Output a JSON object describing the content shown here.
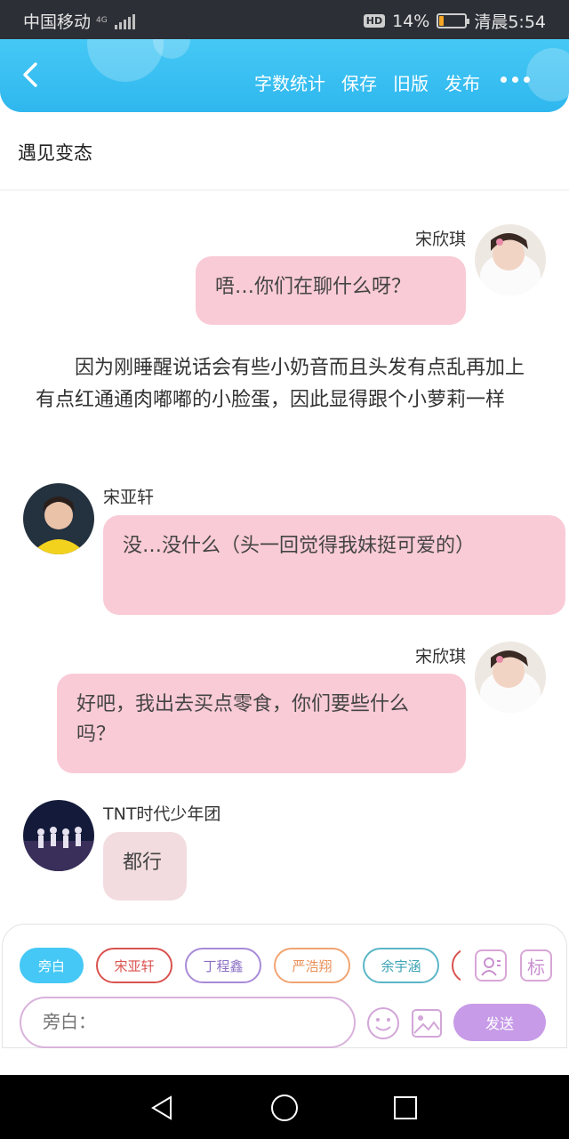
{
  "status": {
    "carrier": "中国移动",
    "net": "4G",
    "battery": "14%",
    "time": "清晨5:54",
    "battery_level": 0.14
  },
  "header": {
    "buttons": [
      "字数统计",
      "保存",
      "旧版",
      "发布"
    ]
  },
  "story": {
    "title": "遇见变态"
  },
  "messages": [
    {
      "name": "宋欣琪",
      "text": "唔…你们在聊什么呀？"
    },
    {
      "narration": "因为刚睡醒说话会有些小奶音而且头发有点乱再加上有点红通通肉嘟嘟的小脸蛋，因此显得跟个小萝莉一样"
    },
    {
      "name": "宋亚轩",
      "text": "没…没什么（头一回觉得我妹挺可爱的）"
    },
    {
      "name": "宋欣琪",
      "text": "好吧，我出去买点零食，你们要些什么吗？"
    },
    {
      "name": "TNT时代少年团",
      "text": "都行"
    }
  ],
  "composer": {
    "chips": [
      "旁白",
      "宋亚轩",
      "丁程鑫",
      "严浩翔",
      "余宇涵"
    ],
    "tag_icon": "标",
    "input_placeholder": "旁白：",
    "send_label": "发送"
  },
  "colors": {
    "accent": "#2fb7ee",
    "bubble": "#f9cbd6",
    "send": "#c79be8"
  }
}
